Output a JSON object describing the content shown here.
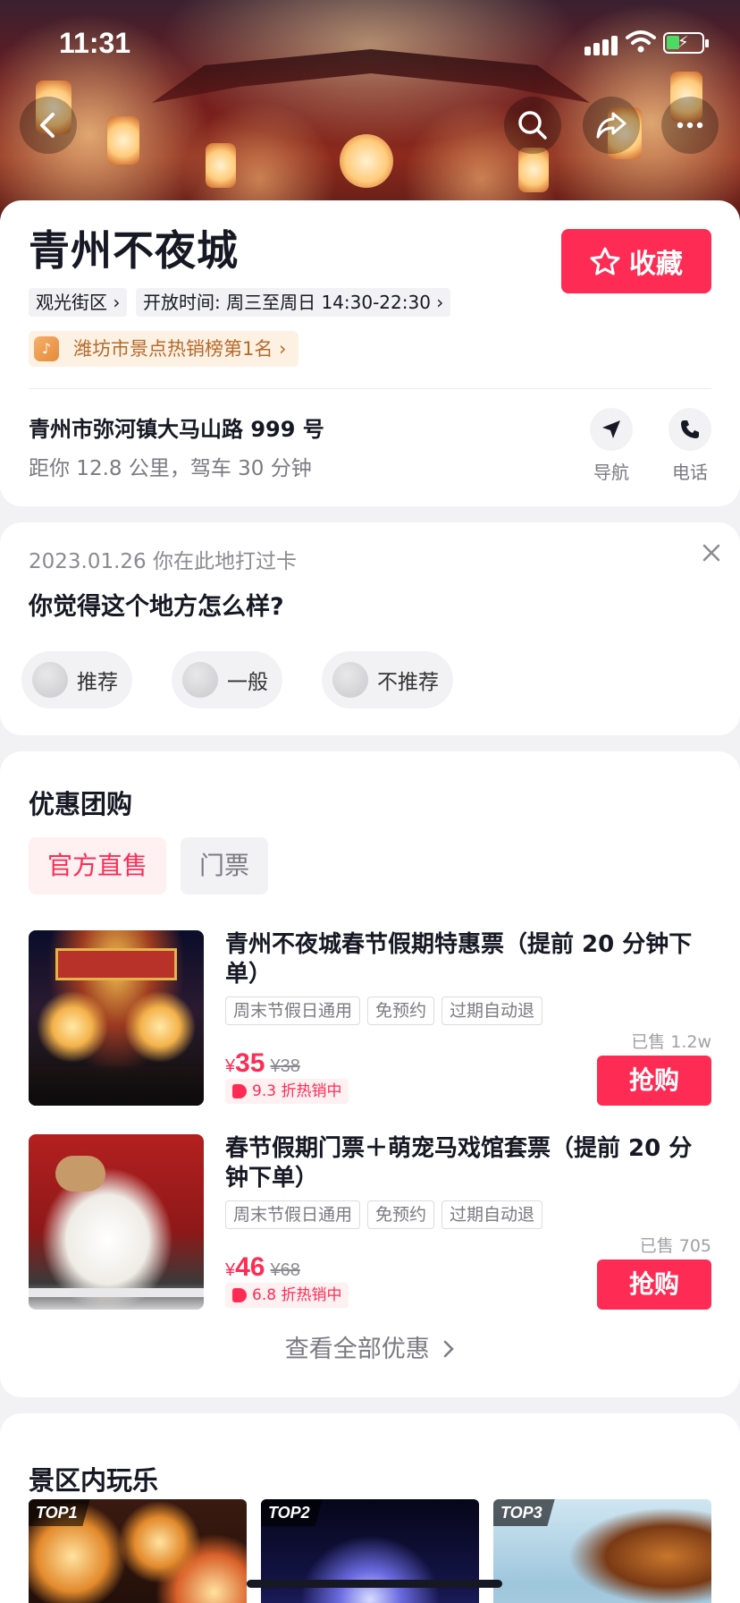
{
  "status": {
    "time": "11:31"
  },
  "poi": {
    "name": "青州不夜城",
    "favorite_label": "收藏",
    "category": "观光街区",
    "hours": "开放时间: 周三至周日 14:30-22:30",
    "rank": "潍坊市景点热销榜第1名",
    "address": "青州市弥河镇大马山路 999 号",
    "distance": "距你 12.8 公里，驾车 30 分钟",
    "nav_label": "导航",
    "phone_label": "电话"
  },
  "feedback": {
    "checkin": "2023.01.26 你在此地打过卡",
    "question": "你觉得这个地方怎么样?",
    "options": [
      "推荐",
      "一般",
      "不推荐"
    ]
  },
  "deals": {
    "title": "优惠团购",
    "tabs": [
      "官方直售",
      "门票"
    ],
    "items": [
      {
        "name": "青州不夜城春节假期特惠票（提前 20 分钟下单）",
        "tags": [
          "周末节假日通用",
          "免预约",
          "过期自动退"
        ],
        "currency": "¥",
        "price": "35",
        "orig_price": "¥38",
        "discount": "9.3 折热销中",
        "sold": "已售 1.2w",
        "buy_label": "抢购"
      },
      {
        "name": "春节假期门票＋萌宠马戏馆套票（提前 20 分钟下单）",
        "tags": [
          "周末节假日通用",
          "免预约",
          "过期自动退"
        ],
        "currency": "¥",
        "price": "46",
        "orig_price": "¥68",
        "discount": "6.8 折热销中",
        "sold": "已售 705",
        "buy_label": "抢购"
      }
    ],
    "more_label": "查看全部优惠"
  },
  "play": {
    "title": "景区内玩乐",
    "badges": [
      "TOP1",
      "TOP2",
      "TOP3"
    ]
  },
  "colors": {
    "accent": "#fe2c55",
    "rank_text": "#b46a2a"
  }
}
